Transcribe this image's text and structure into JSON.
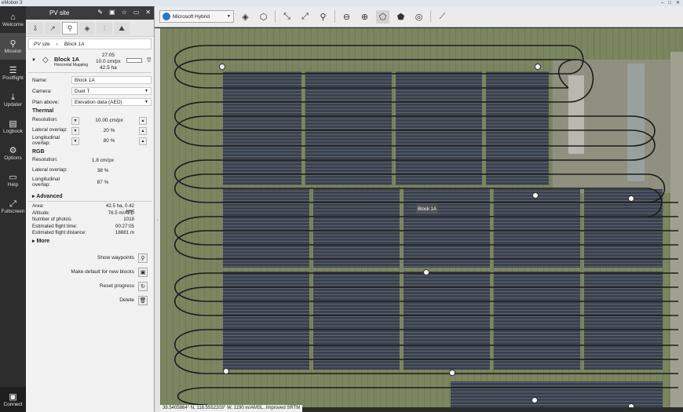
{
  "window": {
    "title": "eMotion 3"
  },
  "nav": {
    "items": [
      {
        "label": "Welcome",
        "icon": "home-icon"
      },
      {
        "label": "Mission",
        "icon": "mission-icon"
      },
      {
        "label": "Postflight",
        "icon": "postflight-icon"
      },
      {
        "label": "Updater",
        "icon": "download-icon"
      },
      {
        "label": "Logbook",
        "icon": "logbook-icon"
      },
      {
        "label": "Options",
        "icon": "gear-icon"
      },
      {
        "label": "Help",
        "icon": "book-icon"
      },
      {
        "label": "Fullscreen",
        "icon": "fullscreen-icon"
      }
    ],
    "connect": "Connect"
  },
  "panel": {
    "title": "PV site",
    "breadcrumb": [
      "PV site",
      "Block 1A"
    ],
    "block": {
      "name": "Block 1A",
      "subtitle": "Horizontal Mapping",
      "time": "27:05",
      "gsd": "10.0 cm/px",
      "area": "42.5 ha"
    },
    "fields": {
      "name_label": "Name:",
      "name_value": "Block 1A",
      "camera_label": "Camera:",
      "camera_value": "Duet T",
      "plan_label": "Plan above:",
      "plan_value": "Elevation data (AED)"
    },
    "thermal": {
      "title": "Thermal",
      "resolution_label": "Resolution:",
      "resolution_value": "10.00 cm/px",
      "lateral_label": "Lateral overlap:",
      "lateral_value": "20 %",
      "long_label": "Longitudinal overlap:",
      "long_value": "80 %"
    },
    "rgb": {
      "title": "RGB",
      "resolution_label": "Resolution:",
      "resolution_value": "1.8 cm/px",
      "lateral_label": "Lateral overlap:",
      "lateral_value": "38 %",
      "long_label": "Longitudinal overlap:",
      "long_value": "87 %"
    },
    "advanced": "Advanced",
    "stats": [
      {
        "k": "Area:",
        "v": "42.5 ha, 0.42 km²"
      },
      {
        "k": "Altitude:",
        "v": "76.5 m/AED"
      },
      {
        "k": "Number of photos:",
        "v": "1018"
      },
      {
        "k": "Estimated flight time:",
        "v": "00:27:05"
      },
      {
        "k": "Estimated flight distance:",
        "v": "18881 m"
      }
    ],
    "more": "More",
    "actions": {
      "show_waypoints": "Show waypoints",
      "make_default": "Make default for new blocks",
      "reset_progress": "Reset progress",
      "delete": "Delete"
    }
  },
  "toolbar": {
    "map_source": "Microsoft Hybrid"
  },
  "map": {
    "block_label": "Block 1A"
  },
  "status": {
    "coords": "39.5405864° N, 118.5552203° W, 1190 m/AMSL, Improved SRTM"
  }
}
